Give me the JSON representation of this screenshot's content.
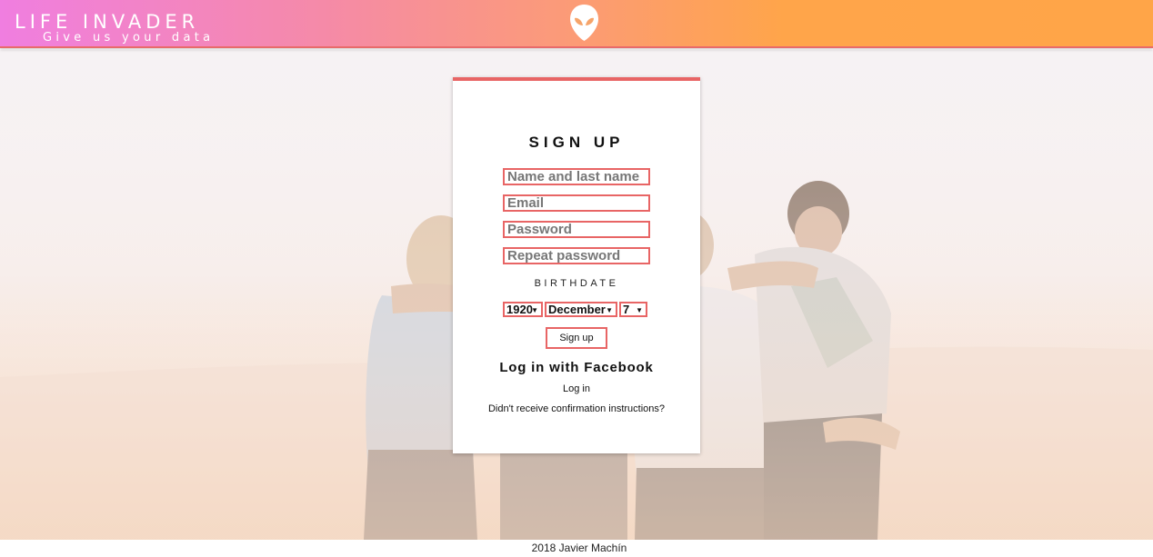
{
  "header": {
    "title": "LIFE INVADER",
    "tagline": "Give us your data",
    "logo_icon": "alien-head-icon"
  },
  "form": {
    "title": "SIGN UP",
    "fields": {
      "name_placeholder": "Name and last name",
      "email_placeholder": "Email",
      "password_placeholder": "Password",
      "repeat_password_placeholder": "Repeat password"
    },
    "birthdate_label": "BIRTHDATE",
    "birthdate": {
      "year": "1920",
      "month": "December",
      "day": "7"
    },
    "signup_button": "Sign up",
    "facebook_login": "Log in with Facebook",
    "login_link": "Log in",
    "confirmation_link": "Didn't receive confirmation instructions?"
  },
  "footer": {
    "text": "2018 Javier Machín"
  },
  "colors": {
    "accent": "#e86565",
    "header_gradient_start": "#f07ee0",
    "header_gradient_end": "#ffa548"
  }
}
